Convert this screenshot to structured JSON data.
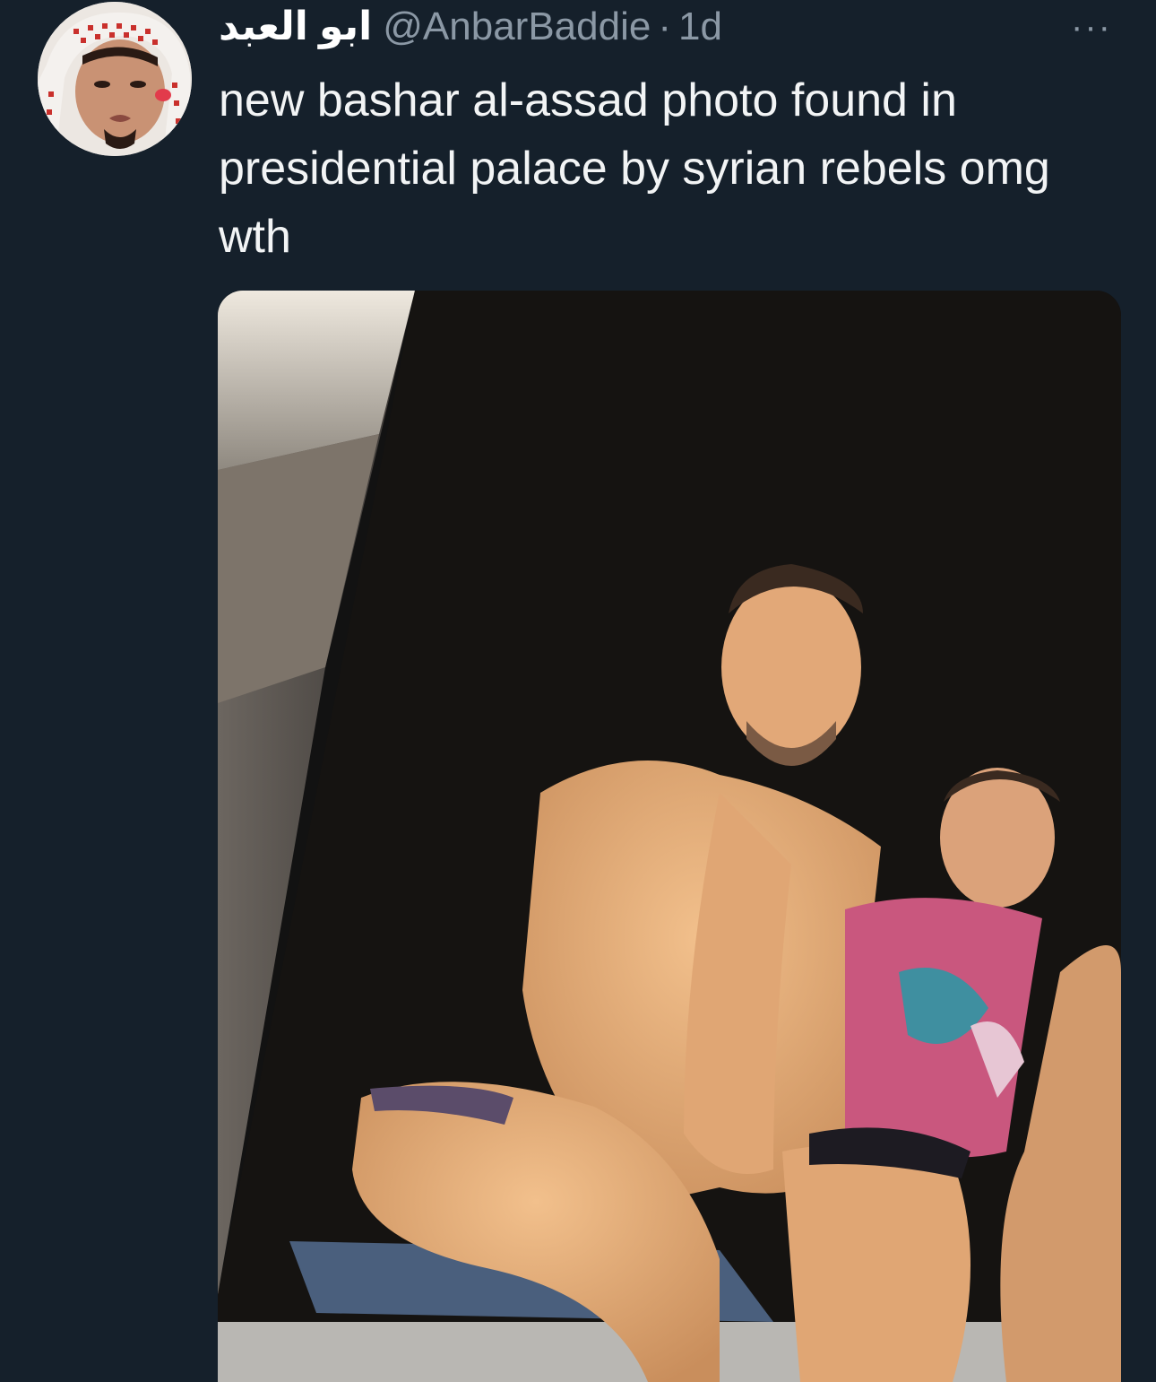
{
  "tweet": {
    "author": {
      "display_name": "ابو العبد",
      "handle": "@AnbarBaddie",
      "avatar_icon": "profile-photo"
    },
    "separator": "·",
    "timestamp": "1d",
    "more_icon": "more-horizontal-icon",
    "more_label": "···",
    "text": "new bashar al-assad photo found in presidential palace by syrian rebels omg wth",
    "media": {
      "type": "photo",
      "icon": "attached-photo"
    }
  },
  "colors": {
    "background": "#15202b",
    "text_primary": "#ffffff",
    "text_secondary": "#8b98a5"
  }
}
